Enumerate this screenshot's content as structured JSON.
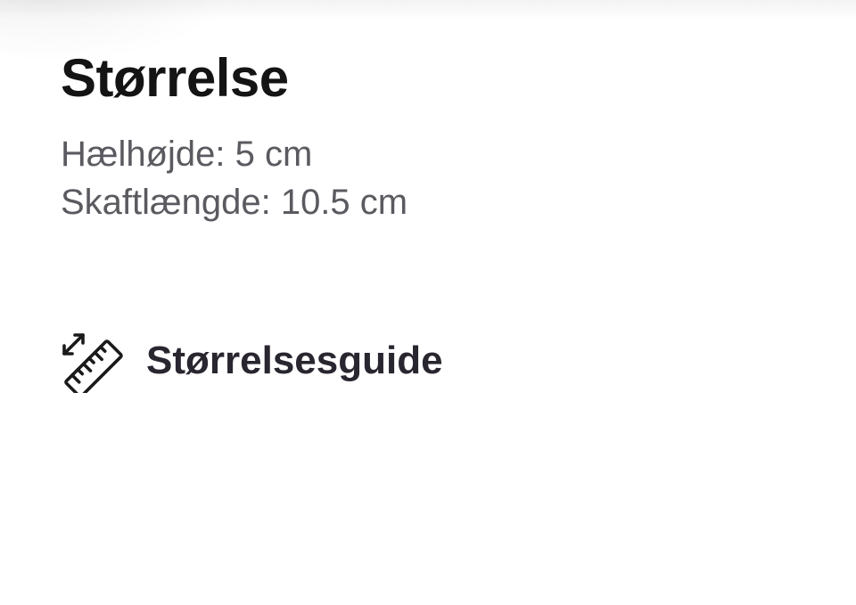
{
  "section": {
    "title": "Størrelse",
    "specs": [
      {
        "text": "Hælhøjde: 5 cm"
      },
      {
        "text": "Skaftlængde: 10.5 cm"
      }
    ]
  },
  "size_guide": {
    "label": "Størrelsesguide",
    "icon": "ruler-resize-icon"
  },
  "colors": {
    "title": "#141414",
    "spec_text": "#5a5a60",
    "link_text": "#2a2630",
    "background": "#ffffff"
  }
}
